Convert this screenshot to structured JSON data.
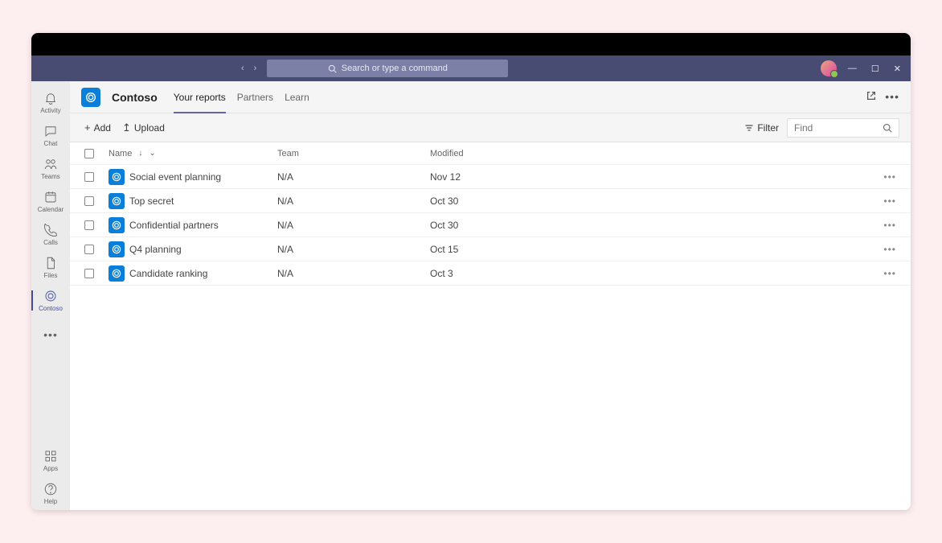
{
  "titlebar": {
    "search_placeholder": "Search or type a command"
  },
  "sidebar": {
    "items": [
      {
        "label": "Activity"
      },
      {
        "label": "Chat"
      },
      {
        "label": "Teams"
      },
      {
        "label": "Calendar"
      },
      {
        "label": "Calls"
      },
      {
        "label": "Files"
      },
      {
        "label": "Contoso"
      }
    ],
    "bottom": [
      {
        "label": "Apps"
      },
      {
        "label": "Help"
      }
    ]
  },
  "app": {
    "title": "Contoso",
    "tabs": [
      {
        "label": "Your reports"
      },
      {
        "label": "Partners"
      },
      {
        "label": "Learn"
      }
    ]
  },
  "toolbar": {
    "add_label": "Add",
    "upload_label": "Upload",
    "filter_label": "Filter",
    "find_placeholder": "Find"
  },
  "table": {
    "cols": {
      "name": "Name",
      "team": "Team",
      "modified": "Modified"
    },
    "rows": [
      {
        "name": "Social event planning",
        "team": "N/A",
        "modified": "Nov 12"
      },
      {
        "name": "Top secret",
        "team": "N/A",
        "modified": "Oct 30"
      },
      {
        "name": "Confidential partners",
        "team": "N/A",
        "modified": "Oct 30"
      },
      {
        "name": "Q4 planning",
        "team": "N/A",
        "modified": "Oct 15"
      },
      {
        "name": "Candidate ranking",
        "team": "N/A",
        "modified": "Oct 3"
      }
    ]
  }
}
